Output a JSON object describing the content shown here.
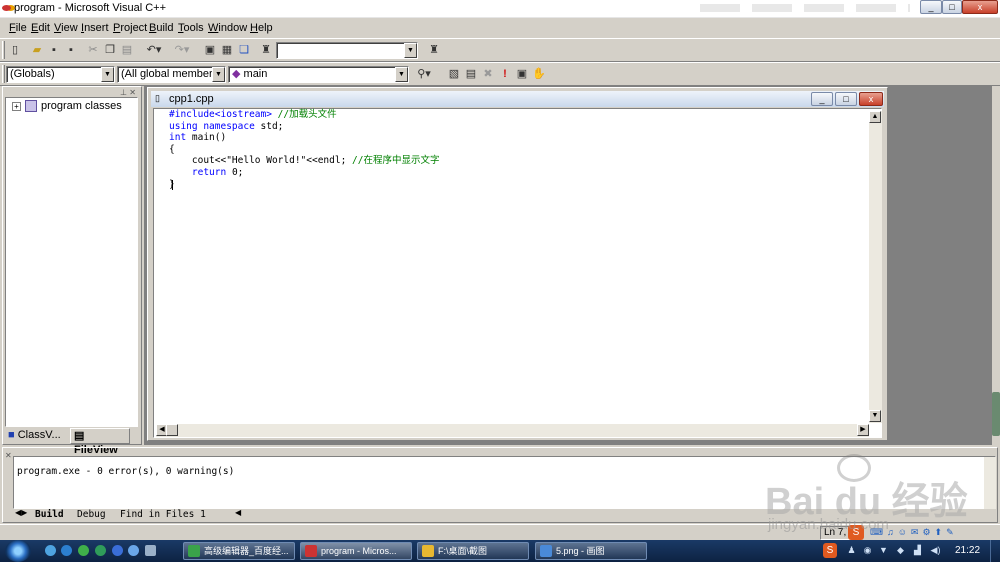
{
  "window": {
    "title": "program - Microsoft Visual C++",
    "min": "_",
    "max": "□",
    "close": "x"
  },
  "menu": [
    "File",
    "Edit",
    "View",
    "Insert",
    "Project",
    "Build",
    "Tools",
    "Window",
    "Help"
  ],
  "wizard": {
    "scope": "(Globals)",
    "filter": "(All global members",
    "member": "main"
  },
  "workspace": {
    "tree_root": "program classes",
    "tab_class": "ClassV...",
    "tab_file": "FileView"
  },
  "editor": {
    "title": "cpp1.cpp",
    "lines": [
      [
        {
          "t": "#include<iostream> ",
          "c": "kw"
        },
        {
          "t": "//加载头文件",
          "c": "cm"
        }
      ],
      [
        {
          "t": "using namespace",
          "c": "kw"
        },
        {
          "t": " std;",
          "c": ""
        }
      ],
      [
        {
          "t": "int",
          "c": "kw"
        },
        {
          "t": " main()",
          "c": ""
        }
      ],
      [
        {
          "t": "{",
          "c": ""
        }
      ],
      [
        {
          "t": "    cout<<\"Hello World!\"<<endl; ",
          "c": ""
        },
        {
          "t": "//在程序中显示文字",
          "c": "cm"
        }
      ],
      [
        {
          "t": "    ",
          "c": ""
        },
        {
          "t": "return",
          "c": "kw"
        },
        {
          "t": " 0;",
          "c": ""
        }
      ],
      [
        {
          "t": "}",
          "c": ""
        }
      ]
    ]
  },
  "output": {
    "text": "program.exe - 0 error(s), 0 warning(s)",
    "tabs": [
      "Build",
      "Debug",
      "Find in Files 1"
    ]
  },
  "status": {
    "position": "Ln 7,"
  },
  "watermark": {
    "brand": "Bai du 经验",
    "url": "jingyan.baidu.com"
  },
  "taskbar": {
    "items": [
      {
        "label": "高级编辑器_百度经...",
        "color": "#3aa34a"
      },
      {
        "label": "program - Micros...",
        "color": "#c33"
      },
      {
        "label": "F:\\桌面\\截图",
        "color": "#e8b830"
      },
      {
        "label": "5.png - 画图",
        "color": "#4a8ad8"
      }
    ],
    "clock": "21:22"
  }
}
